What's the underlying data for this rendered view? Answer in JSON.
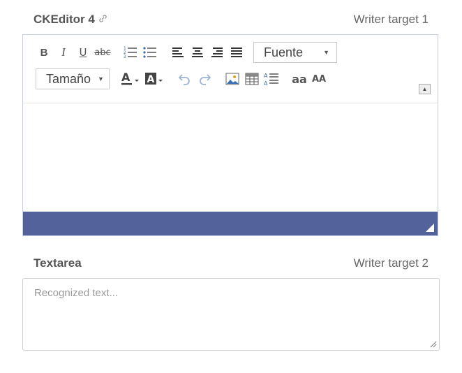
{
  "field1": {
    "label": "CKEditor 4",
    "target": "Writer target 1"
  },
  "toolbar": {
    "row1": [
      {
        "name": "bold-button",
        "icon": "B"
      },
      {
        "name": "italic-button",
        "icon": "I"
      },
      {
        "name": "underline-button",
        "icon": "U"
      },
      {
        "name": "strikethrough-button",
        "icon": "abc"
      }
    ],
    "font_combo": "Fuente",
    "size_combo": "Tamaño",
    "font_case_lower": "aa",
    "font_case_upper": "AA"
  },
  "field2": {
    "label": "Textarea",
    "target": "Writer target 2",
    "placeholder": "Recognized text..."
  },
  "colors": {
    "statusbar": "#53629b",
    "editor_border": "#c7cce6"
  }
}
